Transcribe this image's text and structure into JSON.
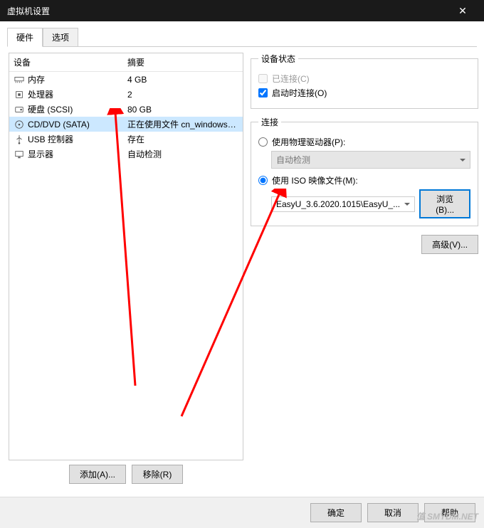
{
  "window": {
    "title": "虚拟机设置",
    "close_glyph": "✕"
  },
  "tabs": {
    "hardware": "硬件",
    "options": "选项"
  },
  "list": {
    "header_device": "设备",
    "header_summary": "摘要",
    "rows": [
      {
        "name": "内存",
        "summary": "4 GB"
      },
      {
        "name": "处理器",
        "summary": "2"
      },
      {
        "name": "硬盘 (SCSI)",
        "summary": "80 GB"
      },
      {
        "name": "CD/DVD (SATA)",
        "summary": "正在使用文件 cn_windows_1..."
      },
      {
        "name": "USB 控制器",
        "summary": "存在"
      },
      {
        "name": "显示器",
        "summary": "自动检测"
      }
    ]
  },
  "left_buttons": {
    "add": "添加(A)...",
    "remove": "移除(R)"
  },
  "status": {
    "legend": "设备状态",
    "connected": "已连接(C)",
    "connect_on_start": "启动时连接(O)"
  },
  "connection": {
    "legend": "连接",
    "physical": "使用物理驱动器(P):",
    "physical_value": "自动检测",
    "iso": "使用 ISO 映像文件(M):",
    "iso_value": "EasyU_3.6.2020.1015\\EasyU_...",
    "browse": "浏览(B)..."
  },
  "advanced": "高级(V)...",
  "bottom": {
    "ok": "确定",
    "cancel": "取消",
    "help": "帮助"
  },
  "watermark": "值 SMYDM.NET"
}
